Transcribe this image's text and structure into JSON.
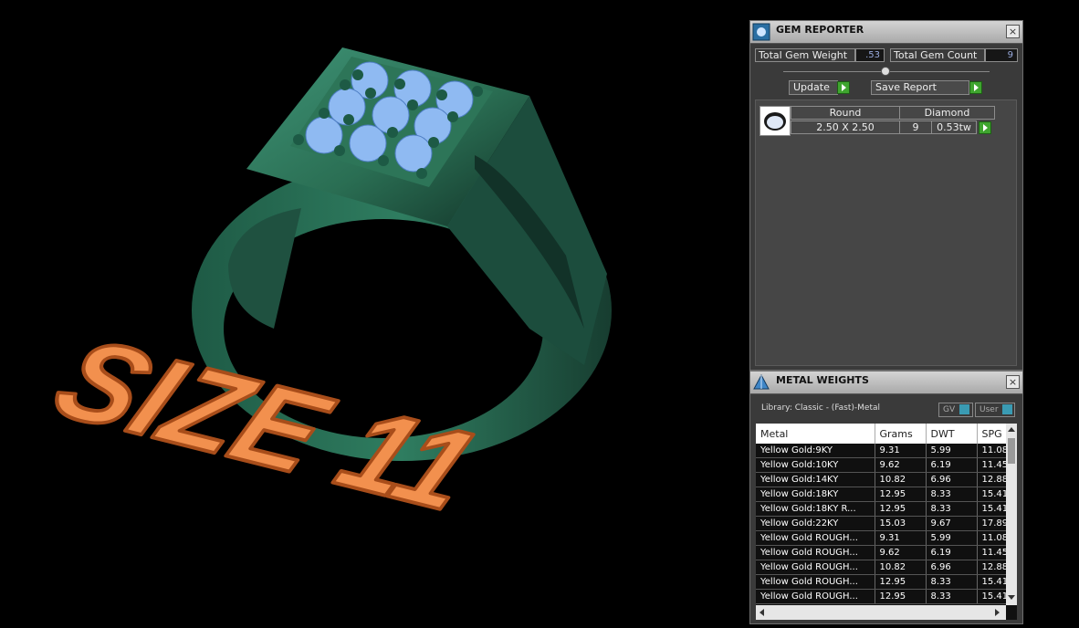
{
  "viewport": {
    "size_text": "SIZE 11"
  },
  "gem_reporter": {
    "title": "GEM REPORTER",
    "close": "×",
    "total_gem_weight_label": "Total Gem Weight",
    "total_gem_weight_value": ".53",
    "total_gem_count_label": "Total Gem Count",
    "total_gem_count_value": "9",
    "update_label": "Update",
    "save_report_label": "Save Report",
    "gem_row": {
      "shape": "Round",
      "material": "Diamond",
      "size": "2.50 X 2.50",
      "count": "9",
      "weight": "0.53tw"
    }
  },
  "metal_weights": {
    "title": "METAL WEIGHTS",
    "close": "×",
    "library": "Library: Classic - (Fast)-Metal",
    "gv_label": "GV",
    "user_label": "User",
    "columns": [
      "Metal",
      "Grams",
      "DWT",
      "SPG"
    ],
    "rows": [
      [
        "Yellow Gold:9KY",
        "9.31",
        "5.99",
        "11.08"
      ],
      [
        "Yellow Gold:10KY",
        "9.62",
        "6.19",
        "11.45"
      ],
      [
        "Yellow Gold:14KY",
        "10.82",
        "6.96",
        "12.88"
      ],
      [
        "Yellow Gold:18KY",
        "12.95",
        "8.33",
        "15.41"
      ],
      [
        "Yellow Gold:18KY R...",
        "12.95",
        "8.33",
        "15.41"
      ],
      [
        "Yellow Gold:22KY",
        "15.03",
        "9.67",
        "17.89"
      ],
      [
        "Yellow Gold ROUGH...",
        "9.31",
        "5.99",
        "11.08"
      ],
      [
        "Yellow Gold ROUGH...",
        "9.62",
        "6.19",
        "11.45"
      ],
      [
        "Yellow Gold ROUGH...",
        "10.82",
        "6.96",
        "12.88"
      ],
      [
        "Yellow Gold ROUGH...",
        "12.95",
        "8.33",
        "15.41"
      ],
      [
        "Yellow Gold ROUGH...",
        "12.95",
        "8.33",
        "15.41"
      ]
    ]
  },
  "colors": {
    "ring": "#2e7a5c",
    "gem": "#8fbaf2",
    "text3d": "#f2904e",
    "panel": "#3a3a3a",
    "accent_green": "#3fa52f"
  }
}
